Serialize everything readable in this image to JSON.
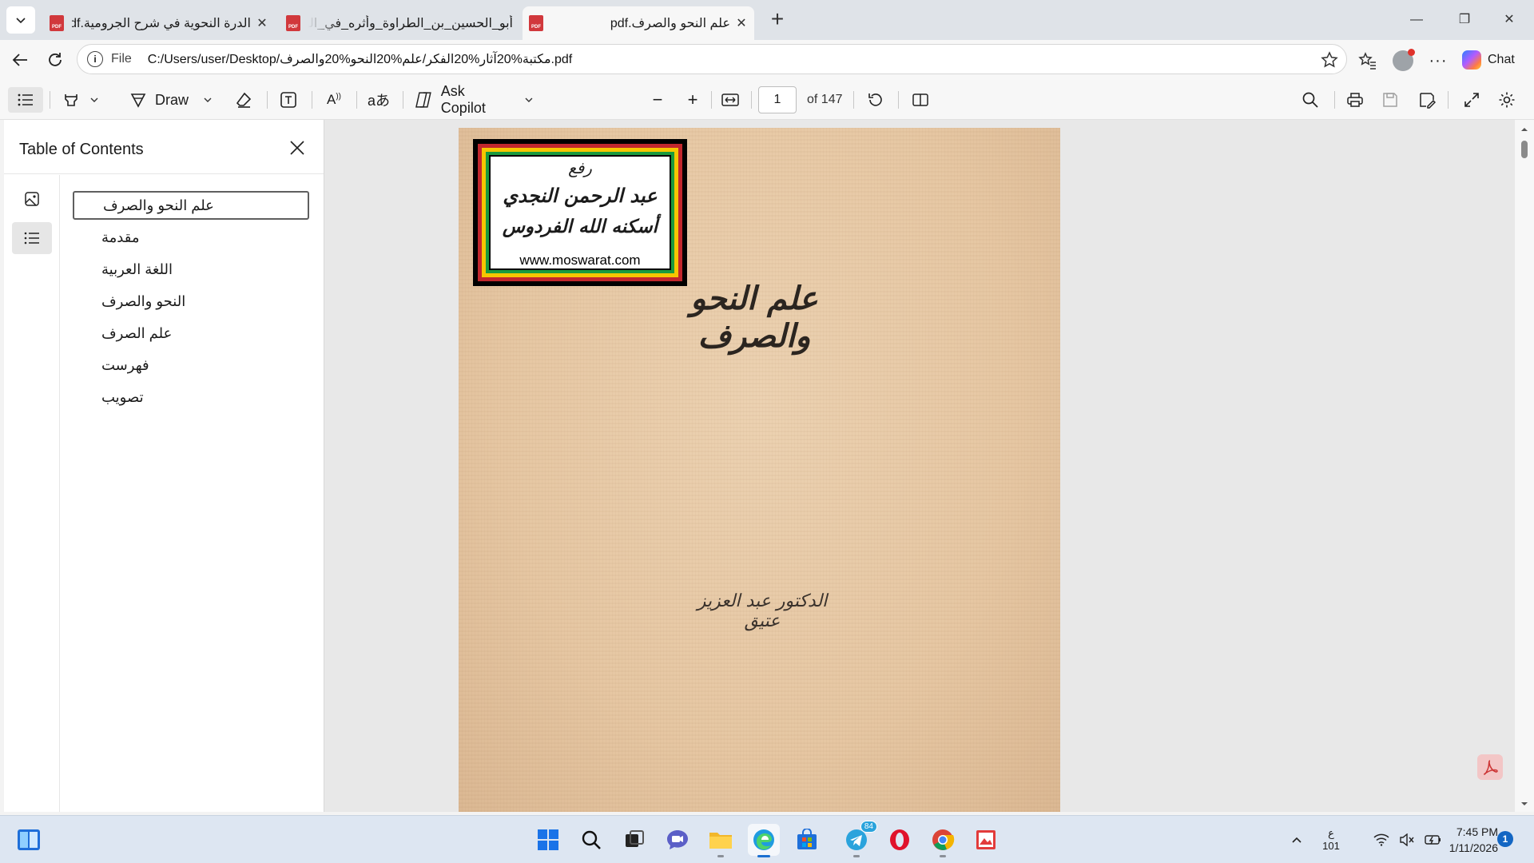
{
  "browser": {
    "tabs": [
      {
        "title": "الدرة النحوية في شرح الجرومية.pdf",
        "active": false
      },
      {
        "title": "أبو_الحسين_بن_الطراوة_وأثره_في_النحو.pdf",
        "active": false
      },
      {
        "title": "علم النحو والصرف.pdf",
        "active": true
      }
    ],
    "address": {
      "scheme": "File",
      "url": "C:/Users/user/Desktop/مكتبة%20آثار%20الفكر/علم%20النحو%20والصرف.pdf"
    },
    "chat_label": "Chat"
  },
  "pdf_toolbar": {
    "draw_label": "Draw",
    "ask_copilot_label": "Ask Copilot",
    "page_number": "1",
    "page_count": "of 147"
  },
  "sidebar": {
    "title": "Table of Contents",
    "toc_items": [
      {
        "label": "علم النحو والصرف",
        "selected": true
      },
      {
        "label": "مقدمة",
        "selected": false
      },
      {
        "label": "اللغة العربية",
        "selected": false
      },
      {
        "label": "النحو والصرف",
        "selected": false
      },
      {
        "label": "علم الصرف",
        "selected": false
      },
      {
        "label": "فهرست",
        "selected": false
      },
      {
        "label": "تصويب",
        "selected": false
      }
    ]
  },
  "document": {
    "stamp_lines": [
      "رفع",
      "عبد الرحمن النجدي",
      "أسكنه الله الفردوس"
    ],
    "stamp_site": "www.moswarat.com",
    "cover_title": "علم النحو والصرف",
    "cover_author": "الدكتور عبد العزيز عتيق"
  },
  "taskbar": {
    "telegram_badge": "84",
    "lang_top": "ع",
    "lang_bottom": "101",
    "time": "7:45 PM",
    "date": "1/11/2026",
    "notification_count": "1"
  },
  "colors": {
    "accent": "#1b6fd1",
    "pdf_red": "#d1383c",
    "page_paper": "#e6c7a3"
  }
}
